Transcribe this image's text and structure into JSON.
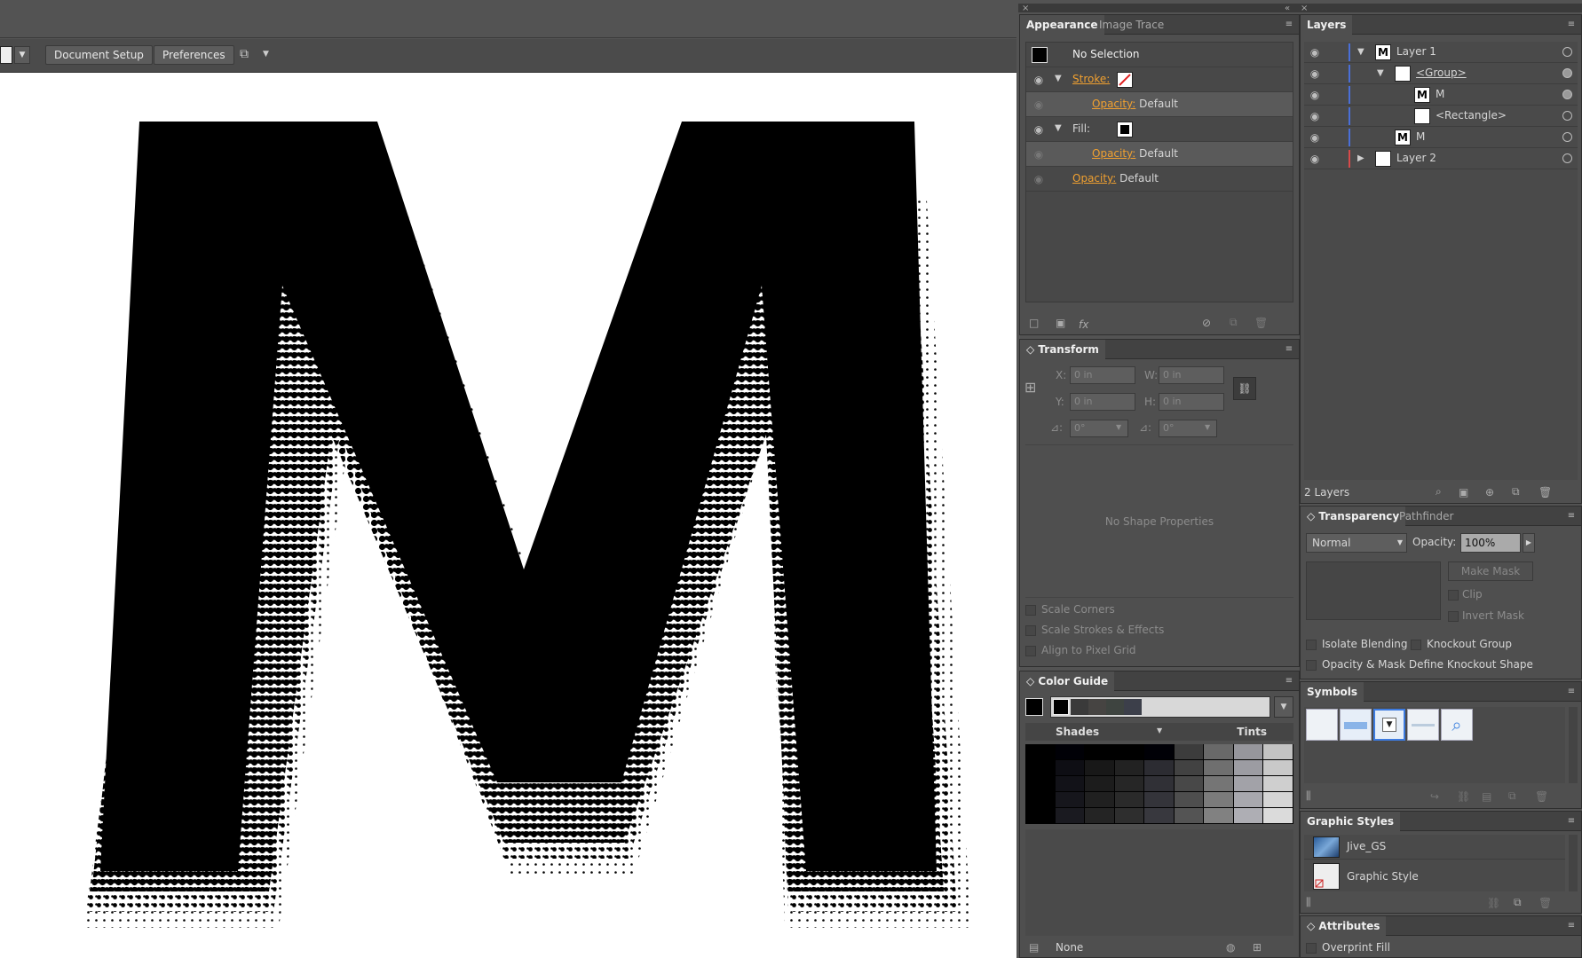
{
  "control_bar": {
    "document_setup": "Document Setup",
    "preferences": "Preferences"
  },
  "appearance_panel": {
    "tabs": [
      "Appearance",
      "Image Trace"
    ],
    "selection": "No Selection",
    "stroke_label": "Stroke:",
    "fill_label": "Fill:",
    "opacity_label": "Opacity:",
    "opacity_value": "Default",
    "footer_fx": "fx"
  },
  "transform_panel": {
    "title": "Transform",
    "x_label": "X:",
    "y_label": "Y:",
    "w_label": "W:",
    "h_label": "H:",
    "x_value": "0 in",
    "y_value": "0 in",
    "w_value": "0 in",
    "h_value": "0 in",
    "rotate_value": "0°",
    "shear_value": "0°",
    "no_shape": "No Shape Properties",
    "checkboxes": [
      "Scale Corners",
      "Scale Strokes & Effects",
      "Align to Pixel Grid"
    ]
  },
  "color_guide": {
    "title": "Color Guide",
    "shades": "Shades",
    "tints": "Tints",
    "footer_none": "None",
    "guide_colors": [
      "#3a3a3a",
      "#464442",
      "#3e4440",
      "#3c3f4a"
    ]
  },
  "layers_panel": {
    "title": "Layers",
    "rows": [
      {
        "name": "Layer 1",
        "thumb": "M",
        "indent": 0,
        "arrow": "down",
        "color": "#4a6fd8"
      },
      {
        "name": "<Group>",
        "thumb": "",
        "indent": 1,
        "arrow": "down",
        "color": "#4a6fd8"
      },
      {
        "name": "M",
        "thumb": "M",
        "indent": 2,
        "arrow": "",
        "color": "#4a6fd8"
      },
      {
        "name": "<Rectangle>",
        "thumb": "",
        "indent": 2,
        "arrow": "",
        "color": "#4a6fd8"
      },
      {
        "name": "M",
        "thumb": "M",
        "indent": 1,
        "arrow": "",
        "color": "#4a6fd8"
      },
      {
        "name": "Layer 2",
        "thumb": "",
        "indent": 0,
        "arrow": "right",
        "color": "#d84a4a"
      }
    ],
    "count": "2 Layers"
  },
  "transparency_panel": {
    "tabs": [
      "Transparency",
      "Pathfinder"
    ],
    "blend_mode": "Normal",
    "opacity_label": "Opacity:",
    "opacity_value": "100%",
    "make_mask": "Make Mask",
    "clip": "Clip",
    "invert_mask": "Invert Mask",
    "isolate": "Isolate Blending",
    "knockout": "Knockout Group",
    "define_knockout": "Opacity & Mask Define Knockout Shape"
  },
  "symbols_panel": {
    "title": "Symbols"
  },
  "graphic_styles_panel": {
    "title": "Graphic Styles",
    "items": [
      "Jive_GS",
      "Graphic Style"
    ]
  },
  "attributes_panel": {
    "title": "Attributes",
    "overprint": "Overprint Fill"
  }
}
